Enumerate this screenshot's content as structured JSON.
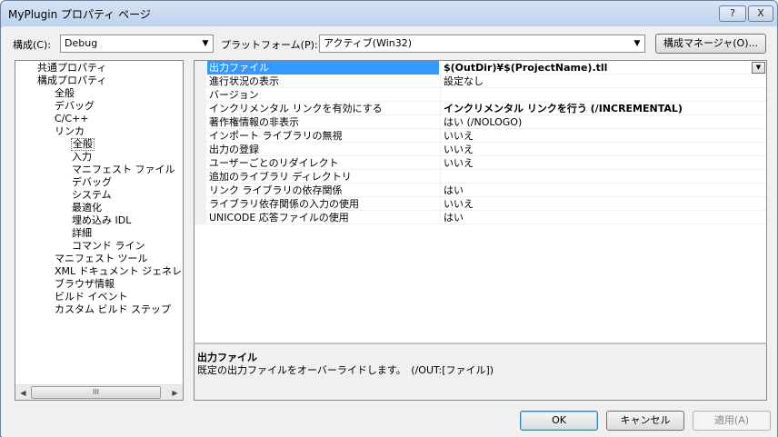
{
  "window": {
    "title": "MyPlugin プロパティ ページ",
    "help_label": "?",
    "close_label": "X"
  },
  "toolbar": {
    "config_label": "構成(C):",
    "config_value": "Debug",
    "platform_label": "プラットフォーム(P):",
    "platform_value": "アクティブ(Win32)",
    "config_manager_label": "構成マネージャ(O)..."
  },
  "tree": {
    "items": [
      {
        "label": "共通プロパティ"
      },
      {
        "label": "構成プロパティ"
      },
      {
        "label": "全般"
      },
      {
        "label": "デバッグ"
      },
      {
        "label": "C/C++"
      },
      {
        "label": "リンカ"
      },
      {
        "label": "全般"
      },
      {
        "label": "入力"
      },
      {
        "label": "マニフェスト ファイル"
      },
      {
        "label": "デバッグ"
      },
      {
        "label": "システム"
      },
      {
        "label": "最適化"
      },
      {
        "label": "埋め込み IDL"
      },
      {
        "label": "詳細"
      },
      {
        "label": "コマンド ライン"
      },
      {
        "label": "マニフェスト ツール"
      },
      {
        "label": "XML ドキュメント ジェネレー"
      },
      {
        "label": "ブラウザ情報"
      },
      {
        "label": "ビルド イベント"
      },
      {
        "label": "カスタム ビルド ステップ"
      }
    ],
    "scroll_left": "◀",
    "scroll_right": "▶",
    "thumb_grip": "III"
  },
  "grid": {
    "rows": [
      {
        "name": "出力ファイル",
        "value": "$(OutDir)¥$(ProjectName).tll"
      },
      {
        "name": "進行状況の表示",
        "value": "設定なし"
      },
      {
        "name": "バージョン",
        "value": ""
      },
      {
        "name": "インクリメンタル リンクを有効にする",
        "value": "インクリメンタル リンクを行う (/INCREMENTAL)"
      },
      {
        "name": "著作権情報の非表示",
        "value": "はい (/NOLOGO)"
      },
      {
        "name": "インポート ライブラリの無視",
        "value": "いいえ"
      },
      {
        "name": "出力の登録",
        "value": "いいえ"
      },
      {
        "name": "ユーザーごとのリダイレクト",
        "value": "いいえ"
      },
      {
        "name": "追加のライブラリ ディレクトリ",
        "value": ""
      },
      {
        "name": "リンク ライブラリの依存関係",
        "value": "はい"
      },
      {
        "name": "ライブラリ依存関係の入力の使用",
        "value": "いいえ"
      },
      {
        "name": "UNICODE 応答ファイルの使用",
        "value": "はい"
      }
    ],
    "dropdown_arrow": "▼"
  },
  "description": {
    "title": "出力ファイル",
    "text": "既定の出力ファイルをオーバーライドします。　(/OUT:[ファイル])"
  },
  "buttons": {
    "ok": "OK",
    "cancel": "キャンセル",
    "apply": "適用(A)"
  },
  "colors": {
    "selection": "#3399ff",
    "window_bg": "#f0f0f0"
  }
}
